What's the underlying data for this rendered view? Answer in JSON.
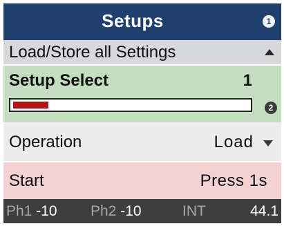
{
  "title": "Setups",
  "badges": {
    "title_badge": "1",
    "select_badge": "2"
  },
  "section": {
    "label": "Load/Store all Settings"
  },
  "setup_select": {
    "label": "Setup Select",
    "value": "1",
    "progress": 0.15
  },
  "operation": {
    "label": "Operation",
    "value": "Load"
  },
  "start": {
    "label": "Start",
    "value": "Press 1s"
  },
  "status": {
    "ph1_label": "Ph1",
    "ph1_value": "-10",
    "ph2_label": "Ph2",
    "ph2_value": "-10",
    "int_label": "INT",
    "int_value": "44.1"
  },
  "colors": {
    "title_bg": "#1f3f6d",
    "section_bg": "#d6d8dc",
    "select_bg": "#c3dfbf",
    "operation_bg": "#ececec",
    "start_bg": "#f2d2d2",
    "status_bg": "#3e3e3e",
    "progress_fill": "#b31414"
  },
  "icons": {
    "title_badge": "number-1-badge-icon",
    "section": "collapse-up-icon",
    "select_badge": "number-2-badge-icon",
    "operation": "dropdown-arrow-icon"
  }
}
